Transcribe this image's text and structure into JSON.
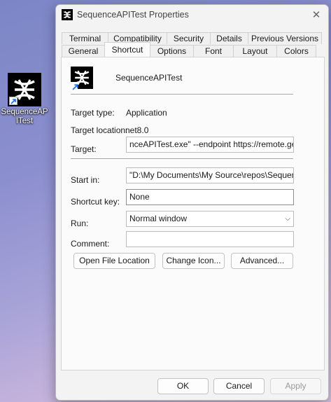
{
  "desktop": {
    "icon_label": "SequenceAPITest"
  },
  "window": {
    "title": "SequenceAPITest Properties",
    "close_glyph": "✕"
  },
  "tabs": {
    "row1": [
      "Terminal",
      "Compatibility",
      "Security",
      "Details",
      "Previous Versions"
    ],
    "row2": [
      "General",
      "Shortcut",
      "Options",
      "Font",
      "Layout",
      "Colors"
    ],
    "active": "Shortcut"
  },
  "shortcut": {
    "name": "SequenceAPITest",
    "target_type_label": "Target type:",
    "target_type_value": "Application",
    "target_location_label": "Target location:",
    "target_location_value": "net8.0",
    "target_label": "Target:",
    "target_value": "nceAPITest.exe\" --endpoint https://remote.getseq",
    "start_in_label": "Start in:",
    "start_in_value": "\"D:\\My Documents\\My Source\\repos\\Sequence.",
    "shortcut_key_label": "Shortcut key:",
    "shortcut_key_value": "None",
    "run_label": "Run:",
    "run_value": "Normal window",
    "comment_label": "Comment:",
    "comment_value": ""
  },
  "buttons": {
    "open_file_location": "Open File Location",
    "change_icon": "Change Icon...",
    "advanced": "Advanced...",
    "ok": "OK",
    "cancel": "Cancel",
    "apply": "Apply"
  },
  "icons": {
    "app": "sequence-logo-icon",
    "shortcut_overlay": "shortcut-arrow-icon",
    "close": "close-icon",
    "dropdown": "chevron-down-icon"
  }
}
